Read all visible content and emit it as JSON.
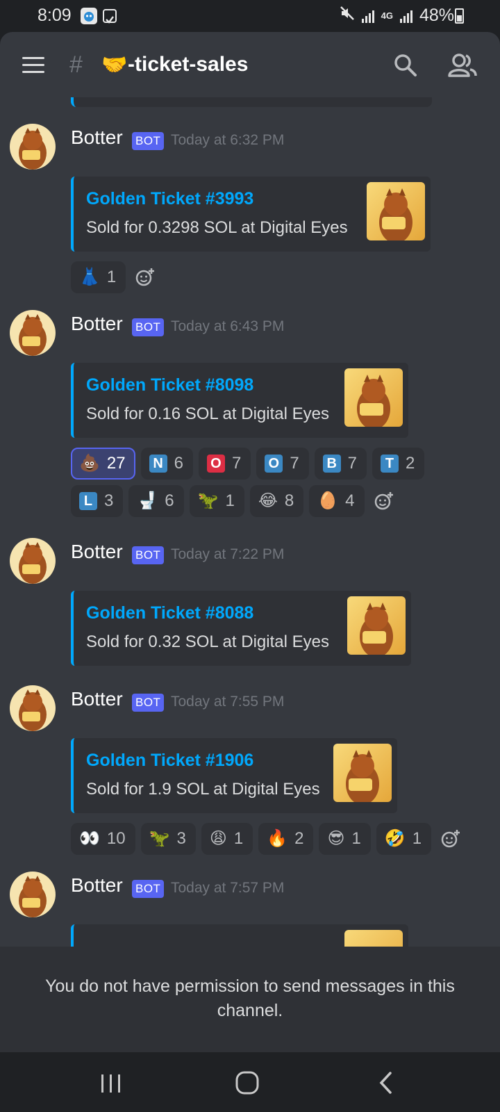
{
  "status_bar": {
    "time": "8:09",
    "network": "4G",
    "battery": "48%"
  },
  "header": {
    "hash": "#",
    "channel_emoji": "🤝",
    "channel_name": "-ticket-sales"
  },
  "messages": [
    {
      "username": "Botter",
      "bot_tag": "BOT",
      "timestamp": "Today at 6:32 PM",
      "embed": {
        "title": "Golden Ticket #3993",
        "description": "Sold for 0.3298 SOL at Digital Eyes"
      },
      "reactions": [
        {
          "emoji": "👗",
          "count": "1"
        }
      ]
    },
    {
      "username": "Botter",
      "bot_tag": "BOT",
      "timestamp": "Today at 6:43 PM",
      "embed": {
        "title": "Golden Ticket #8098",
        "description": "Sold for 0.16 SOL at Digital Eyes"
      },
      "reactions": [
        {
          "emoji": "💩",
          "count": "27"
        },
        {
          "letter": "N",
          "color": "#3b88c3",
          "count": "6"
        },
        {
          "letter": "O",
          "color": "#dd2e44",
          "count": "7"
        },
        {
          "letter": "O",
          "color": "#3b88c3",
          "count": "7"
        },
        {
          "letter": "B",
          "color": "#3b88c3",
          "count": "7"
        },
        {
          "letter": "T",
          "color": "#3b88c3",
          "count": "2"
        },
        {
          "letter": "L",
          "color": "#3b88c3",
          "count": "3"
        },
        {
          "emoji": "🚽",
          "count": "6"
        },
        {
          "emoji": "🦖",
          "count": "1"
        },
        {
          "emoji": "😂",
          "count": "8"
        },
        {
          "emoji": "🥚",
          "count": "4"
        }
      ]
    },
    {
      "username": "Botter",
      "bot_tag": "BOT",
      "timestamp": "Today at 7:22 PM",
      "embed": {
        "title": "Golden Ticket #8088",
        "description": "Sold for 0.32 SOL at Digital Eyes"
      }
    },
    {
      "username": "Botter",
      "bot_tag": "BOT",
      "timestamp": "Today at 7:55 PM",
      "embed": {
        "title": "Golden Ticket #1906",
        "description": "Sold for 1.9 SOL at Digital Eyes"
      },
      "reactions": [
        {
          "emoji": "👀",
          "count": "10"
        },
        {
          "emoji": "🦖",
          "count": "3"
        },
        {
          "emoji": "😩",
          "count": "1"
        },
        {
          "emoji": "🔥",
          "count": "2"
        },
        {
          "emoji": "😎",
          "count": "1"
        },
        {
          "emoji": "🤣",
          "count": "1"
        }
      ]
    },
    {
      "username": "Botter",
      "bot_tag": "BOT",
      "timestamp": "Today at 7:57 PM"
    }
  ],
  "notice": "You do not have permission to send messages in this channel.",
  "colors": {
    "accent": "#5865f2",
    "link": "#00a8fc",
    "background": "#36393f",
    "embed": "#2f3136"
  }
}
